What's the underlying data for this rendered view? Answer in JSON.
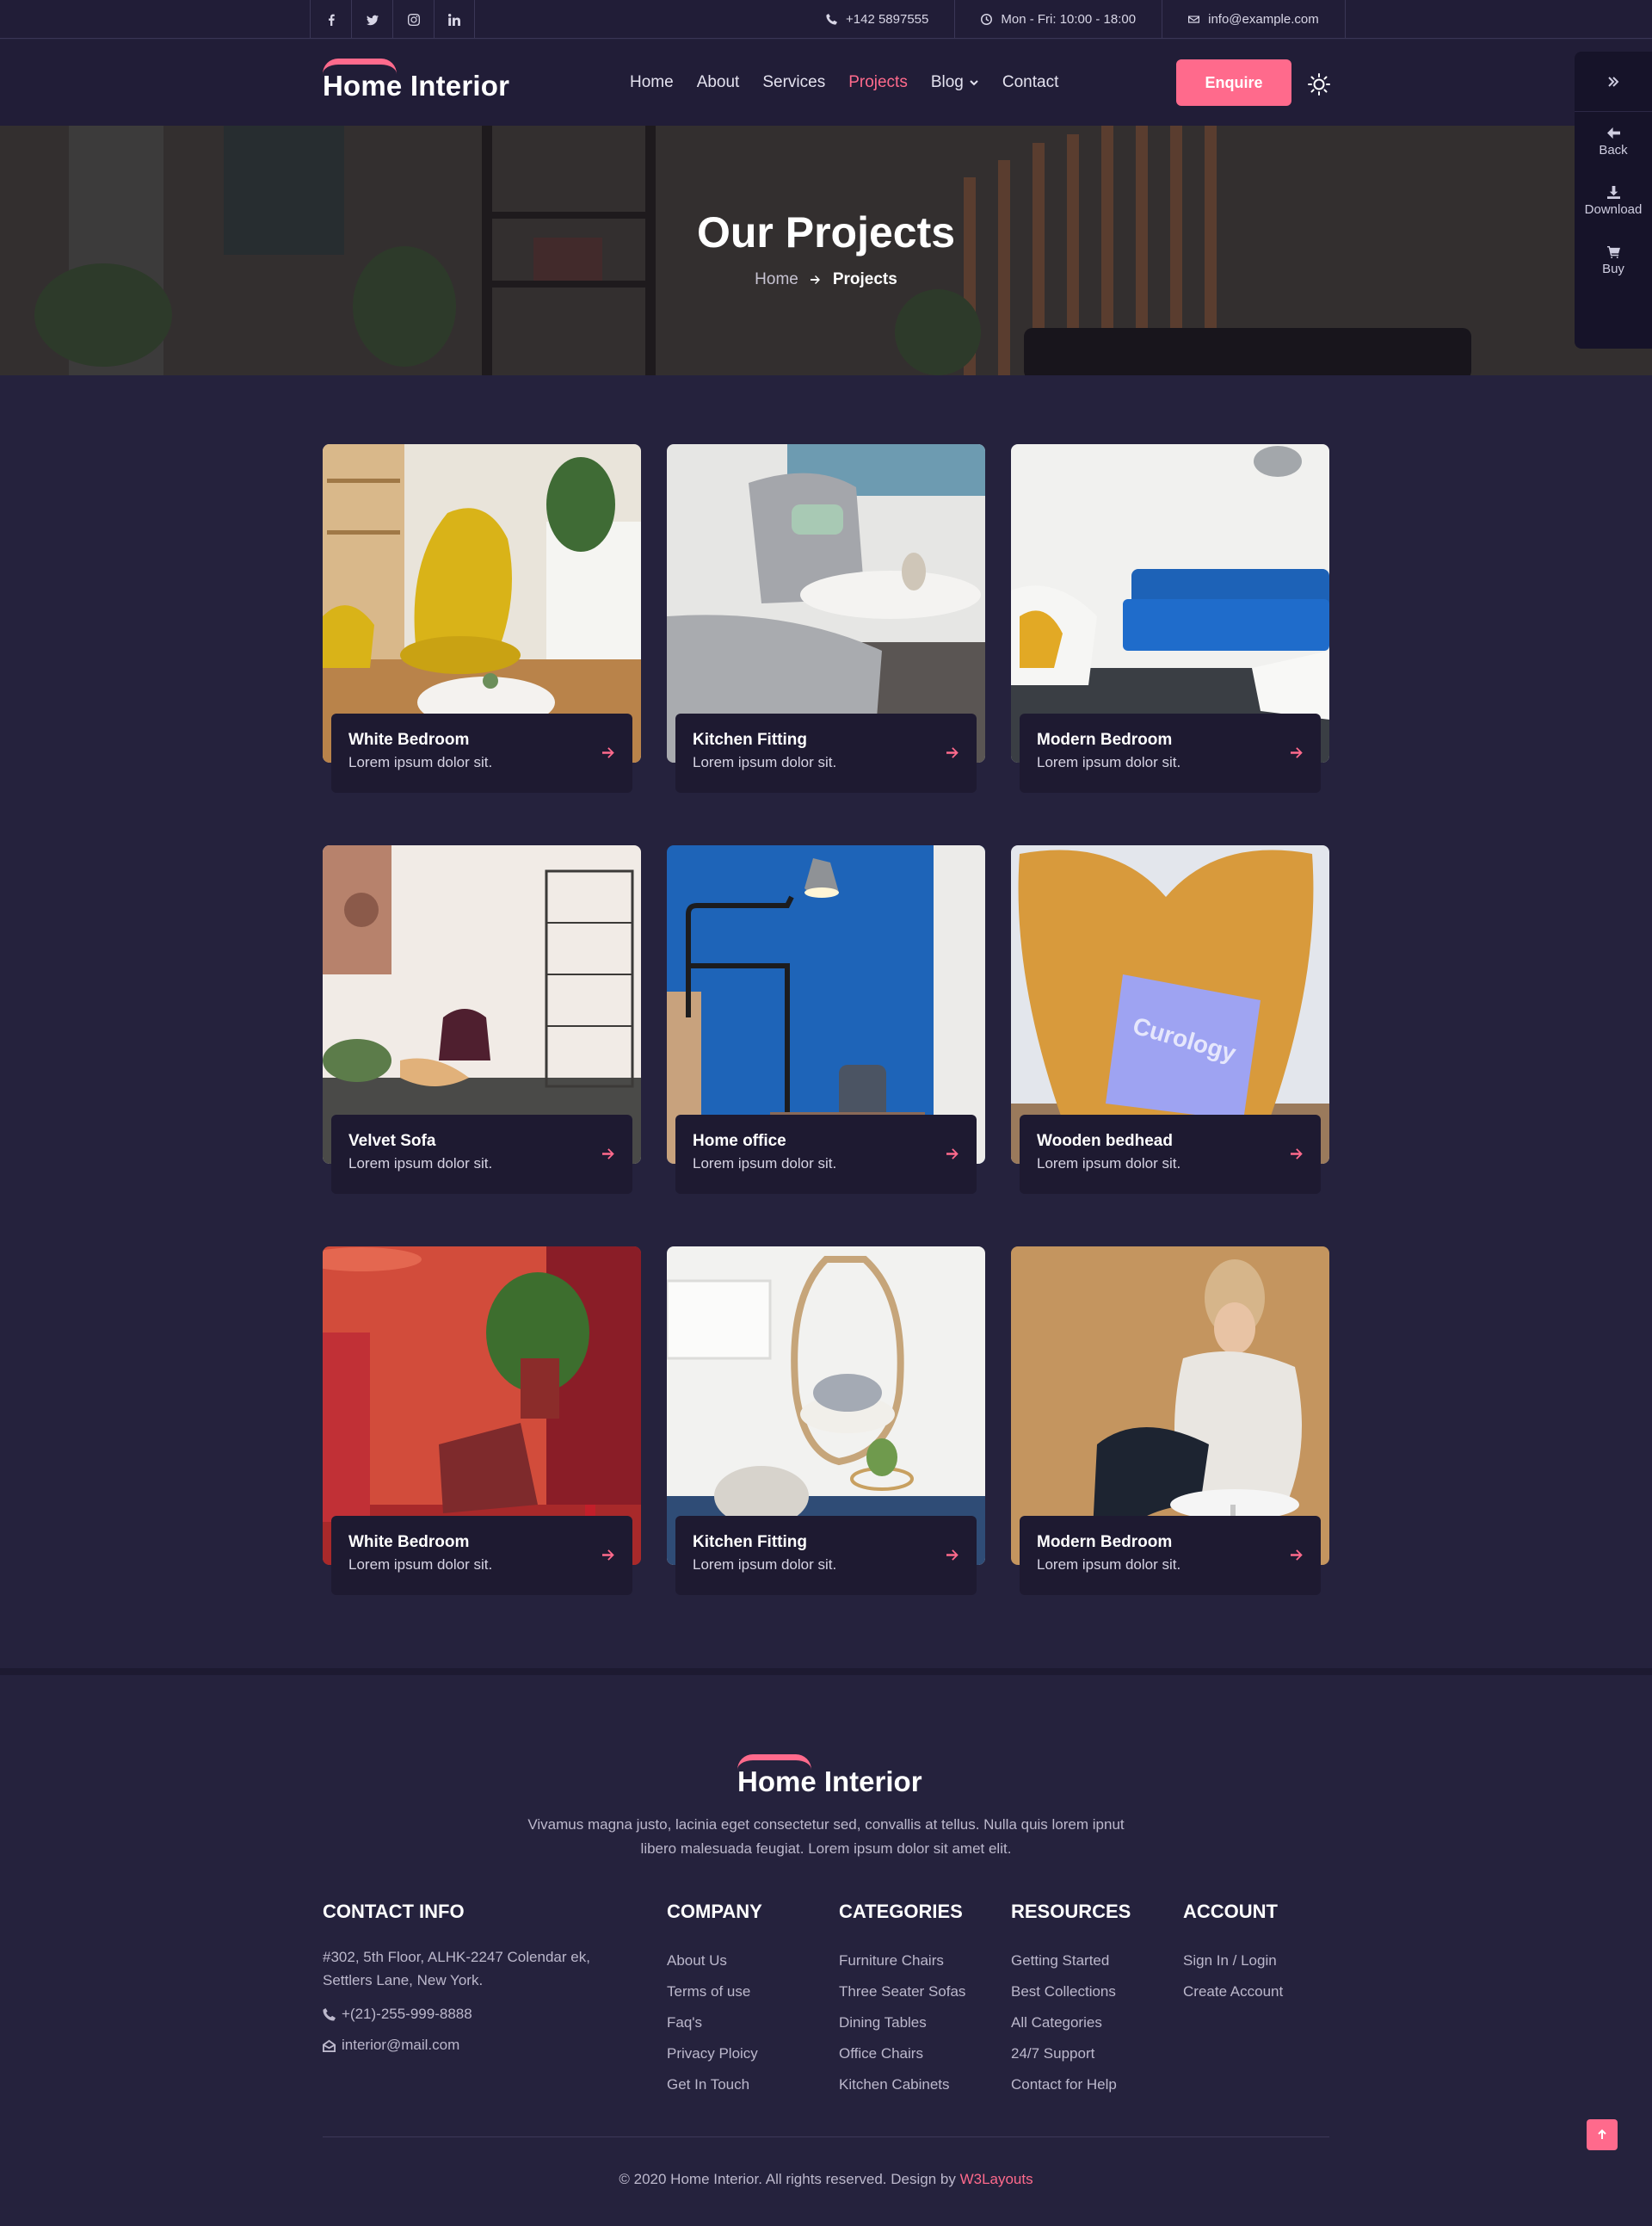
{
  "topbar": {
    "social": [
      "facebook-icon",
      "twitter-icon",
      "instagram-icon",
      "linkedin-icon"
    ],
    "phone": "+142 5897555",
    "hours": "Mon - Fri: 10:00 - 18:00",
    "email": "info@example.com"
  },
  "header": {
    "logo": "Home Interior",
    "nav": [
      {
        "label": "Home"
      },
      {
        "label": "About"
      },
      {
        "label": "Services"
      },
      {
        "label": "Projects",
        "active": true
      },
      {
        "label": "Blog",
        "dropdown": true
      },
      {
        "label": "Contact"
      }
    ],
    "enquire": "Enquire"
  },
  "sidepanel": {
    "items": [
      {
        "label": "Back",
        "icon": "arrow-left-icon"
      },
      {
        "label": "Download",
        "icon": "download-icon"
      },
      {
        "label": "Buy",
        "icon": "cart-icon"
      }
    ]
  },
  "banner": {
    "title": "Our Projects",
    "breadcrumb": {
      "home": "Home",
      "current": "Projects"
    }
  },
  "projects": [
    {
      "title": "White Bedroom",
      "desc": "Lorem ipsum dolor sit."
    },
    {
      "title": "Kitchen Fitting",
      "desc": "Lorem ipsum dolor sit."
    },
    {
      "title": "Modern Bedroom",
      "desc": "Lorem ipsum dolor sit."
    },
    {
      "title": "Velvet Sofa",
      "desc": "Lorem ipsum dolor sit."
    },
    {
      "title": "Home office",
      "desc": "Lorem ipsum dolor sit."
    },
    {
      "title": "Wooden bedhead",
      "desc": "Lorem ipsum dolor sit."
    },
    {
      "title": "White Bedroom",
      "desc": "Lorem ipsum dolor sit."
    },
    {
      "title": "Kitchen Fitting",
      "desc": "Lorem ipsum dolor sit."
    },
    {
      "title": "Modern Bedroom",
      "desc": "Lorem ipsum dolor sit."
    }
  ],
  "footer": {
    "logo": "Home Interior",
    "description": "Vivamus magna justo, lacinia eget consectetur sed, convallis at tellus. Nulla quis lorem ipnut libero malesuada feugiat. Lorem ipsum dolor sit amet elit.",
    "contact": {
      "heading": "CONTACT INFO",
      "address": "#302, 5th Floor, ALHK-2247 Colendar ek, Settlers Lane, New York.",
      "phone": "+(21)-255-999-8888",
      "email": "interior@mail.com"
    },
    "company": {
      "heading": "COMPANY",
      "links": [
        "About Us",
        "Terms of use",
        "Faq's",
        "Privacy Ploicy",
        "Get In Touch"
      ]
    },
    "categories": {
      "heading": "CATEGORIES",
      "links": [
        "Furniture Chairs",
        "Three Seater Sofas",
        "Dining Tables",
        "Office Chairs",
        "Kitchen Cabinets"
      ]
    },
    "resources": {
      "heading": "RESOURCES",
      "links": [
        "Getting Started",
        "Best Collections",
        "All Categories",
        "24/7 Support",
        "Contact for Help"
      ]
    },
    "account": {
      "heading": "ACCOUNT",
      "links": [
        "Sign In / Login",
        "Create Account"
      ]
    },
    "copyright": "© 2020 Home Interior. All rights reserved. Design by",
    "designer": "W3Layouts"
  },
  "colors": {
    "accent": "#ff6a8c",
    "background": "#25223d",
    "header": "#211d37",
    "caption": "#1e1a31"
  }
}
